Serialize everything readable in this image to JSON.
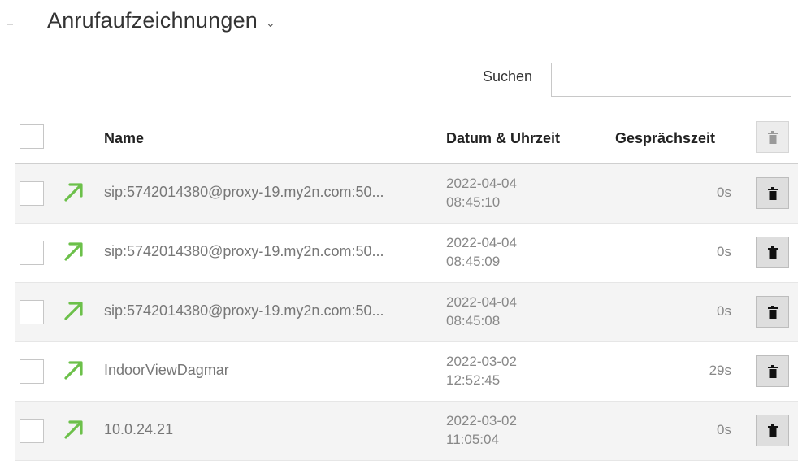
{
  "page": {
    "title": "Anrufaufzeichnungen",
    "title_chevron": "⌄"
  },
  "search": {
    "label": "Suchen",
    "value": "",
    "placeholder": ""
  },
  "table": {
    "columns": {
      "name": "Name",
      "datetime": "Datum & Uhrzeit",
      "talk_time": "Gesprächszeit"
    },
    "rows": [
      {
        "direction": "outgoing-call-icon",
        "name": "sip:5742014380@proxy-19.my2n.com:50...",
        "date": "2022-04-04",
        "time": "08:45:10",
        "duration": "0s"
      },
      {
        "direction": "outgoing-call-icon",
        "name": "sip:5742014380@proxy-19.my2n.com:50...",
        "date": "2022-04-04",
        "time": "08:45:09",
        "duration": "0s"
      },
      {
        "direction": "outgoing-call-icon",
        "name": "sip:5742014380@proxy-19.my2n.com:50...",
        "date": "2022-04-04",
        "time": "08:45:08",
        "duration": "0s"
      },
      {
        "direction": "outgoing-call-icon",
        "name": "IndoorViewDagmar",
        "date": "2022-03-02",
        "time": "12:52:45",
        "duration": "29s"
      },
      {
        "direction": "outgoing-call-icon",
        "name": "10.0.24.21",
        "date": "2022-03-02",
        "time": "11:05:04",
        "duration": "0s"
      }
    ]
  },
  "colors": {
    "arrow": "#6cc04a",
    "trash_active": "#111111",
    "trash_disabled": "#9a9a9a"
  }
}
